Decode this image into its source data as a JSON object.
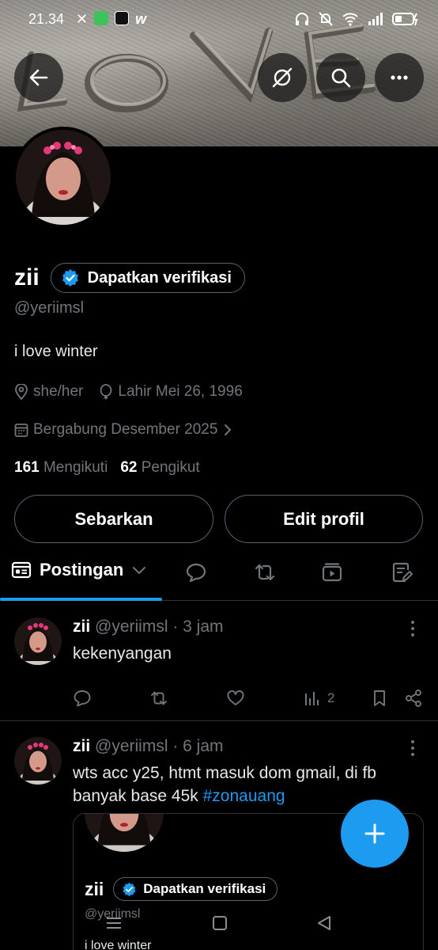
{
  "status_bar": {
    "time": "21.34"
  },
  "profile": {
    "name": "zii",
    "verify_label": "Dapatkan verifikasi",
    "handle": "@yeriimsl",
    "bio": "i love winter",
    "pronouns": "she/her",
    "birthday": "Lahir Mei 26, 1996",
    "joined": "Bergabung Desember 2025",
    "following_count": "161",
    "following_label": "Mengikuti",
    "followers_count": "62",
    "followers_label": "Pengikut"
  },
  "buttons": {
    "share": "Sebarkan",
    "edit": "Edit profil"
  },
  "tabs": {
    "active_label": "Postingan"
  },
  "posts": [
    {
      "name": "zii",
      "handle": "@yeriimsl",
      "time": "· 3 jam",
      "text": "kekenyangan",
      "views": "2"
    },
    {
      "name": "zii",
      "handle": "@yeriimsl",
      "time": "· 6 jam",
      "text": "wts acc y25, htmt masuk dom gmail, di fb banyak base 45k ",
      "hashtag": "#zonauang"
    }
  ],
  "quote": {
    "name": "zii",
    "verify_label": "Dapatkan verifikasi",
    "handle": "@yeriimsl",
    "bio": "i love winter"
  },
  "colors": {
    "accent": "#1d9bf0",
    "muted": "#71767b",
    "border": "#2f3336"
  }
}
